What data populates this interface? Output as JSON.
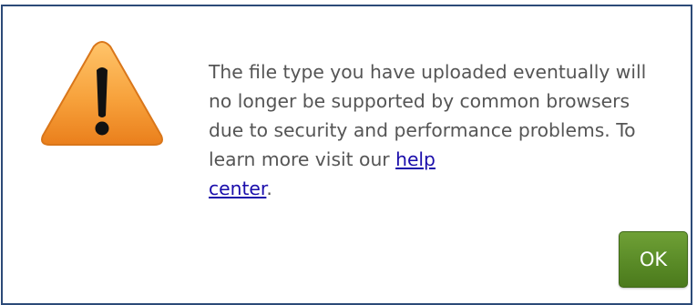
{
  "dialog": {
    "icon": "warning-triangle-icon",
    "message_text": "The file type you have uploaded eventually will no longer be supported by common browsers due to security and performance problems. To learn more visit our ",
    "link_text_1": "help",
    "link_text_2": "center",
    "message_end": ".",
    "ok_label": "OK"
  },
  "colors": {
    "border": "#2c4a78",
    "icon_orange": "#f39c33",
    "button_green": "#5a8b27",
    "link_blue": "#1a0dab",
    "text_gray": "#555555"
  }
}
